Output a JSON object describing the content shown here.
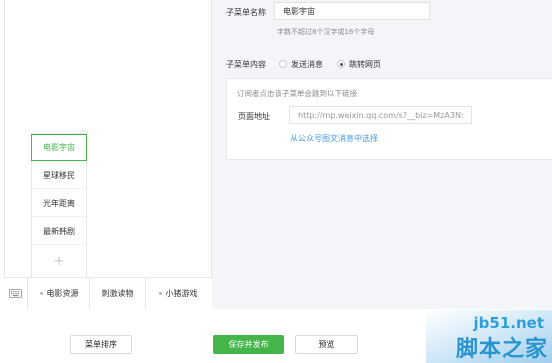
{
  "submenu": {
    "items": [
      {
        "label": "电影宇宙",
        "selected": true
      },
      {
        "label": "星球移民",
        "selected": false
      },
      {
        "label": "光年距离",
        "selected": false
      },
      {
        "label": "最新韩剧",
        "selected": false
      }
    ],
    "add_symbol": "+"
  },
  "bottom_menu": {
    "items": [
      {
        "label": "电影资源",
        "has_dot": true
      },
      {
        "label": "刺激读物",
        "has_dot": false
      },
      {
        "label": "小猪游戏",
        "has_dot": true
      }
    ],
    "keyboard_icon": "keyboard-icon"
  },
  "form": {
    "name_label": "子菜单名称",
    "name_value": "电影宇宙",
    "name_hint": "字数不超过8个汉字或16个字母",
    "content_label": "子菜单内容",
    "radio_send": "发送消息",
    "radio_jump": "跳转网页",
    "selected_radio": "跳转网页",
    "box_hint": "订阅者点击该子菜单会跳到以下链接",
    "url_label": "页面地址",
    "url_value": "http://mp.weixin.qq.com/s?__biz=MzA3N:",
    "select_link": "从公众号图文消息中选择"
  },
  "actions": {
    "sort": "菜单排序",
    "save_publish": "保存并发布",
    "preview": "预览"
  },
  "watermark": {
    "line1": "jb51.net",
    "line2": "脚本之家"
  },
  "colors": {
    "accent_green": "#44b549",
    "link_blue": "#459ae9",
    "panel_bg": "#f4f5f9"
  }
}
